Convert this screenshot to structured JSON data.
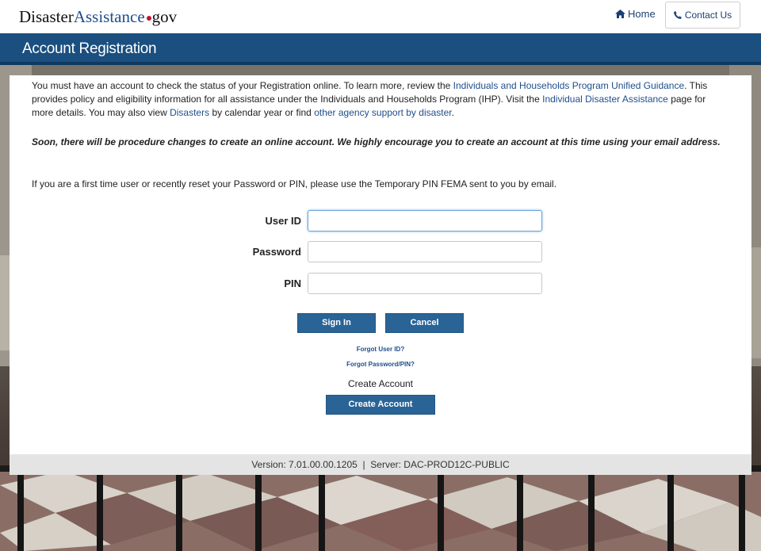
{
  "header": {
    "logo_part1": "Disaster",
    "logo_part2": "Assistance",
    "logo_part3": "gov",
    "home_label": "Home",
    "contact_label": "Contact Us"
  },
  "page_title": "Account Registration",
  "intro": {
    "t1": "You must have an account to check the status of your Registration online. To learn more, review the ",
    "link1": "Individuals and Households Program Unified Guidance",
    "t2": ". This provides policy and eligibility information for all assistance under the Individuals and Households Program (IHP). Visit the ",
    "link2": "Individual Disaster Assistance",
    "t3": " page for more details. You may also view ",
    "link3": "Disasters",
    "t4": " by calendar year or find ",
    "link4": "other agency support by disaster",
    "t5": "."
  },
  "notice": "Soon, there will be procedure changes to create an online account. We highly encourage you to create an account at this time using your email address.",
  "first_time_note": "If you are a first time user or recently reset your Password or PIN, please use the Temporary PIN FEMA sent to you by email.",
  "form": {
    "user_id_label": "User ID",
    "user_id_value": "",
    "password_label": "Password",
    "password_value": "",
    "pin_label": "PIN",
    "pin_value": "",
    "signin_label": "Sign In",
    "cancel_label": "Cancel",
    "forgot_user_id": "Forgot User ID?",
    "forgot_password": "Forgot Password/PIN?",
    "create_account_text": "Create Account",
    "create_account_button": "Create Account"
  },
  "footer": {
    "version": "Version: 7.01.00.00.1205",
    "separator": "|",
    "server": "Server: DAC-PROD12C-PUBLIC"
  },
  "colors": {
    "title_bar": "#1a4f7f",
    "button": "#2a6396",
    "link": "#1f4e8c",
    "logo_dot": "#c4122f"
  },
  "icons": {
    "home": "home-icon",
    "phone": "phone-icon"
  }
}
